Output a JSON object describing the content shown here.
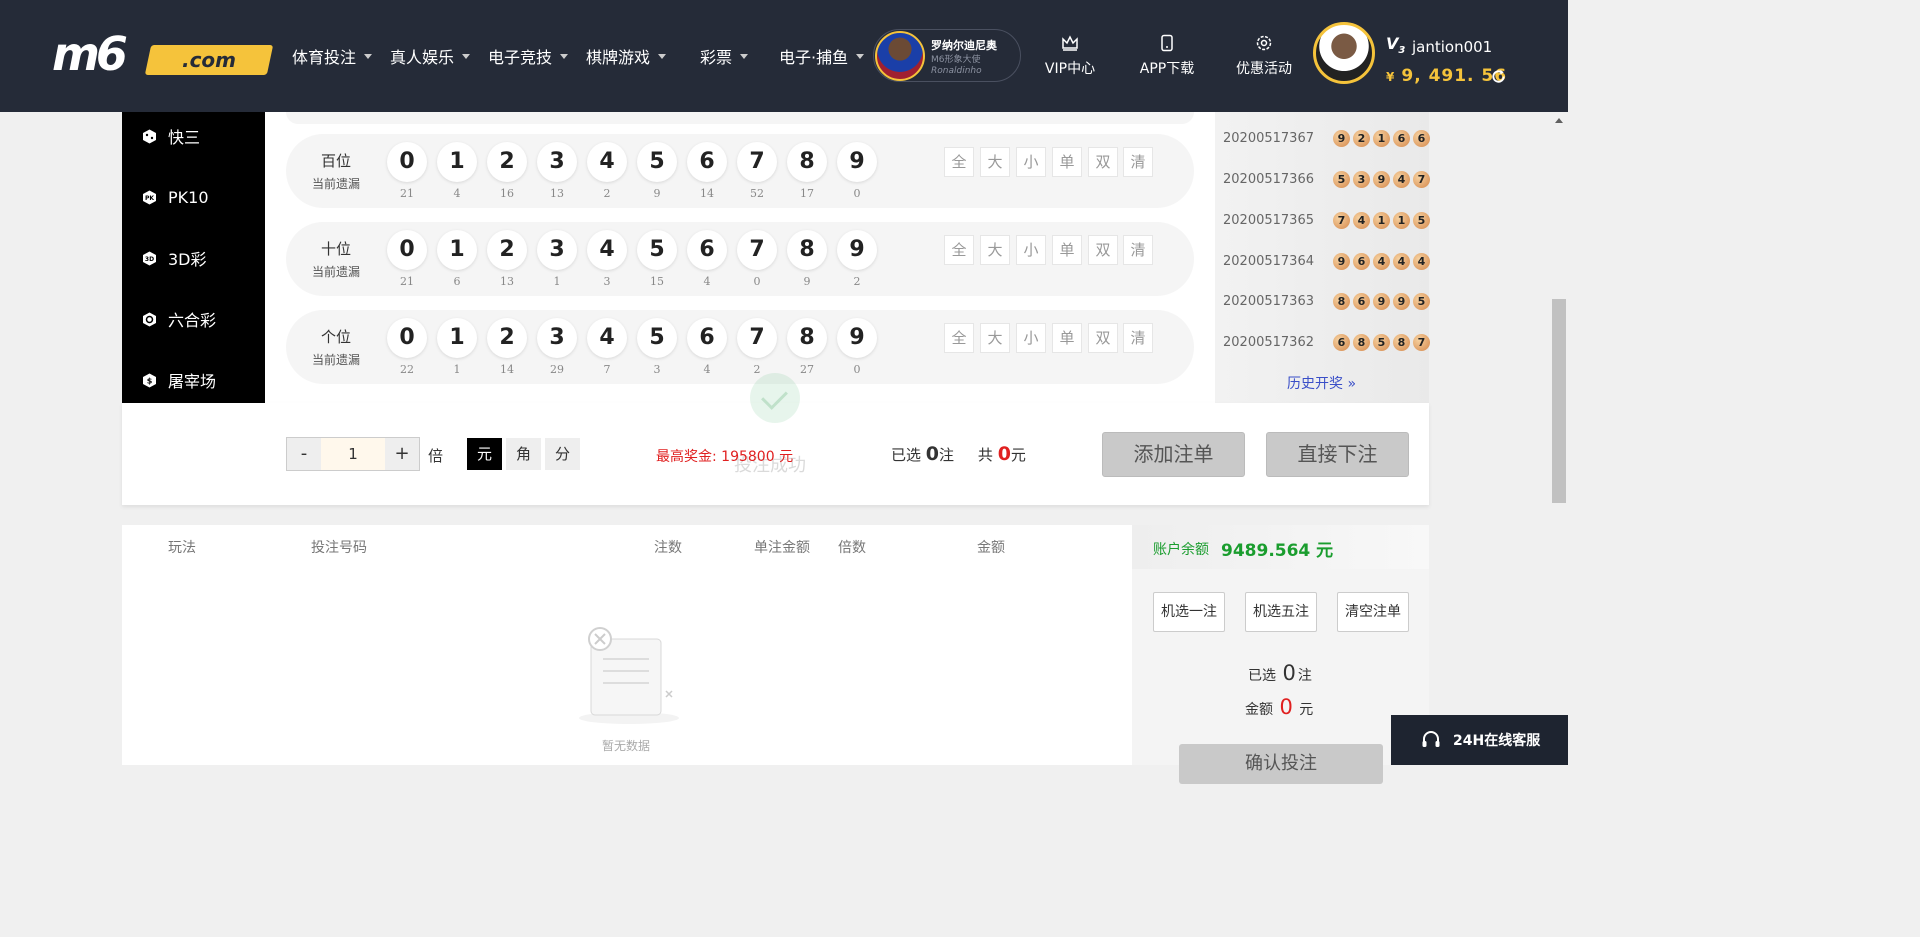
{
  "header": {
    "logo_main": "m6",
    "logo_suffix": ".com",
    "nav": [
      {
        "label": "体育投注"
      },
      {
        "label": "真人娱乐"
      },
      {
        "label": "电子竞技"
      },
      {
        "label": "棋牌游戏"
      },
      {
        "label": "彩票"
      },
      {
        "label": "电子·捕鱼"
      }
    ],
    "ambassador": {
      "name": "罗纳尔迪尼奥",
      "title": "M6形象大使",
      "signature": "Ronaldinho"
    },
    "icons": [
      {
        "label": "VIP中心",
        "icon": "crown-icon"
      },
      {
        "label": "APP下载",
        "icon": "phone-icon"
      },
      {
        "label": "优惠活动",
        "icon": "gift-gear-icon"
      }
    ],
    "user": {
      "vip": "V",
      "vip_level": "3",
      "name": "jantion001",
      "currency": "¥",
      "balance": "9, 491. 56"
    }
  },
  "sidebar": {
    "items": [
      {
        "label": "快三",
        "icon": "dice-icon"
      },
      {
        "label": "PK10",
        "icon": "pk-icon"
      },
      {
        "label": "3D彩",
        "icon": "3d-icon"
      },
      {
        "label": "六合彩",
        "icon": "hexagon-icon"
      },
      {
        "label": "屠宰场",
        "icon": "dollar-hex-icon"
      }
    ]
  },
  "board": {
    "missing_label": "当前遗漏",
    "quick": [
      "全",
      "大",
      "小",
      "单",
      "双",
      "清"
    ],
    "rows": [
      {
        "label": "百位",
        "miss": [
          "21",
          "4",
          "16",
          "13",
          "2",
          "9",
          "14",
          "52",
          "17",
          "0"
        ]
      },
      {
        "label": "十位",
        "miss": [
          "21",
          "6",
          "13",
          "1",
          "3",
          "15",
          "4",
          "0",
          "9",
          "2"
        ]
      },
      {
        "label": "个位",
        "miss": [
          "22",
          "1",
          "14",
          "29",
          "7",
          "3",
          "4",
          "2",
          "27",
          "0"
        ]
      }
    ],
    "digits": [
      "0",
      "1",
      "2",
      "3",
      "4",
      "5",
      "6",
      "7",
      "8",
      "9"
    ]
  },
  "history": {
    "draws": [
      {
        "period": "20200517367",
        "nums": [
          "9",
          "2",
          "1",
          "6",
          "6"
        ]
      },
      {
        "period": "20200517366",
        "nums": [
          "5",
          "3",
          "9",
          "4",
          "7"
        ]
      },
      {
        "period": "20200517365",
        "nums": [
          "7",
          "4",
          "1",
          "1",
          "5"
        ]
      },
      {
        "period": "20200517364",
        "nums": [
          "9",
          "6",
          "4",
          "4",
          "4"
        ]
      },
      {
        "period": "20200517363",
        "nums": [
          "8",
          "6",
          "9",
          "9",
          "5"
        ]
      },
      {
        "period": "20200517362",
        "nums": [
          "6",
          "8",
          "5",
          "8",
          "7"
        ]
      }
    ],
    "link": "历史开奖"
  },
  "controls": {
    "minus": "-",
    "plus": "+",
    "multiple": "1",
    "times_label": "倍",
    "units": [
      "元",
      "角",
      "分"
    ],
    "max_prize_label": "最高奖金:",
    "max_prize_value": "195800 元",
    "selected_label": "已选",
    "selected_count": "0",
    "bet_unit": "注",
    "total_label": "共",
    "total_value": "0",
    "yuan": "元",
    "add_button": "添加注单",
    "direct_button": "直接下注",
    "toast": "投注成功"
  },
  "betlist": {
    "headers": [
      "玩法",
      "投注号码",
      "注数",
      "单注金额",
      "倍数",
      "金额"
    ],
    "empty": "暂无数据"
  },
  "account": {
    "balance_label": "账户余额",
    "balance_value": "9489.564 元",
    "buttons": [
      "机选一注",
      "机选五注",
      "清空注单"
    ],
    "selected_label": "已选",
    "selected_count": "0",
    "bet_unit": "注",
    "amount_label": "金额",
    "amount_value": "0",
    "yuan": "元",
    "confirm": "确认投注"
  },
  "service": {
    "label": "24H在线客服"
  },
  "colors": {
    "header_bg": "#252b38",
    "accent_gold": "#f5c33b",
    "red": "#e02020",
    "green": "#1a9d2e"
  }
}
